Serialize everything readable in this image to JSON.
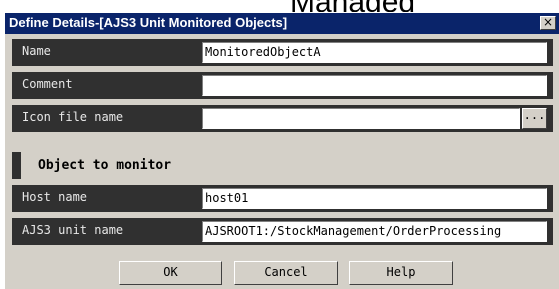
{
  "background_title": "Managed",
  "window": {
    "title": "Define Details-[AJS3 Unit Monitored Objects]",
    "close_symbol": "×"
  },
  "fields": {
    "name": {
      "label": "Name",
      "value": "MonitoredObjectA"
    },
    "comment": {
      "label": "Comment",
      "value": ""
    },
    "icon_file": {
      "label": "Icon file name",
      "value": "",
      "browse_label": "..."
    }
  },
  "section": {
    "title": "Object to monitor"
  },
  "monitor": {
    "host": {
      "label": "Host name",
      "value": "host01"
    },
    "unit": {
      "label": "AJS3 unit name",
      "value": "AJSROOT1:/StockManagement/OrderProcessing"
    }
  },
  "buttons": {
    "ok": "OK",
    "cancel": "Cancel",
    "help": "Help"
  }
}
